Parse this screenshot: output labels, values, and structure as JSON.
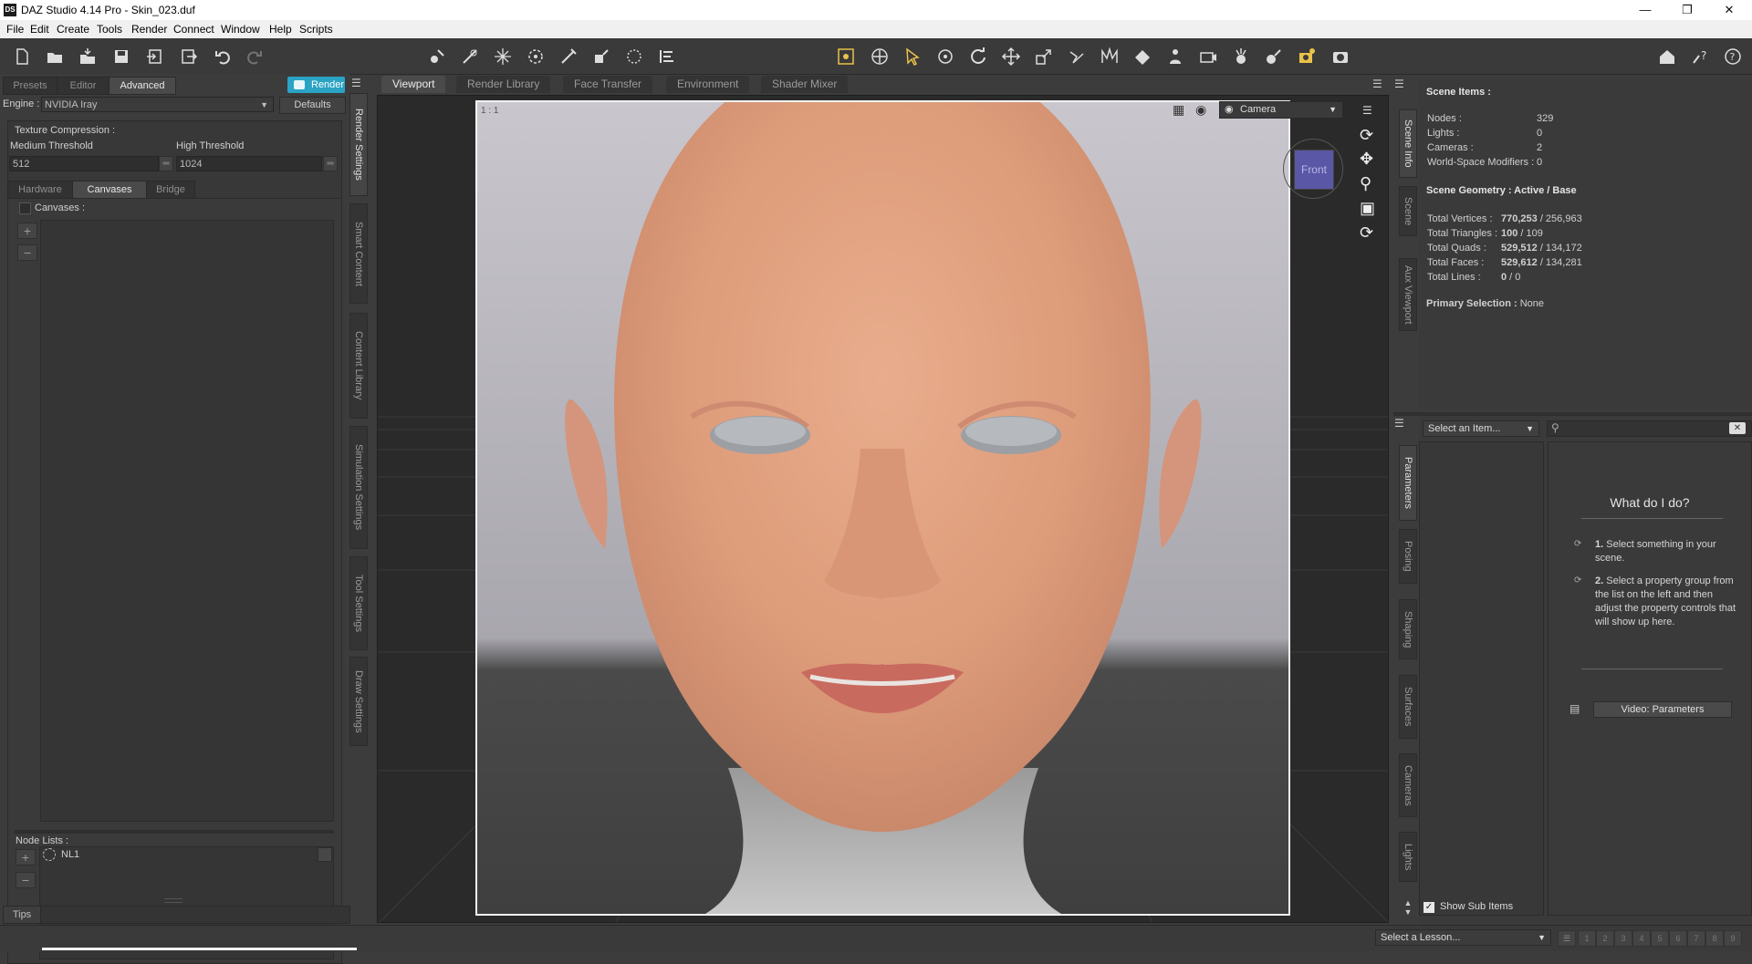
{
  "window": {
    "title": "DAZ Studio 4.14 Pro - Skin_023.duf",
    "logo": "DS",
    "buttons": [
      "minimize-icon",
      "maximize-icon",
      "close-icon"
    ]
  },
  "menu": [
    "File",
    "Edit",
    "Create",
    "Tools",
    "Render",
    "Connect",
    "Window",
    "Help",
    "Scripts"
  ],
  "left": {
    "tabs": [
      "Presets",
      "Editor",
      "Advanced"
    ],
    "render_button": "Render",
    "engine_label": "Engine :",
    "engine_value": "NVIDIA Iray",
    "defaults_button": "Defaults",
    "texture_compression": "Texture Compression :",
    "medium_label": "Medium Threshold",
    "medium_value": "512",
    "high_label": "High Threshold",
    "high_value": "1024",
    "subtabs": [
      "Hardware",
      "Canvases",
      "Bridge"
    ],
    "canvases_label": "Canvases :",
    "node_lists_label": "Node Lists :",
    "node_list_item": "NL1",
    "tips_tab": "Tips"
  },
  "left_vtabs": [
    "Render Settings",
    "Smart Content",
    "Content Library",
    "Simulation Settings",
    "Tool Settings",
    "Draw Settings"
  ],
  "viewport": {
    "tabs": [
      "Viewport",
      "Render Library",
      "Face Transfer",
      "Environment",
      "Shader Mixer"
    ],
    "ratio": "1 : 1",
    "camera": "Camera",
    "cube_face": "Front"
  },
  "scene_info": {
    "title": "Scene Items :",
    "items": [
      {
        "label": "Nodes :",
        "value": "329"
      },
      {
        "label": "Lights :",
        "value": "0"
      },
      {
        "label": "Cameras :",
        "value": "2"
      },
      {
        "label": "World-Space Modifiers :",
        "value": "0"
      }
    ],
    "geometry_title": "Scene Geometry : Active / Base",
    "geometry": [
      {
        "label": "Total Vertices :",
        "active": "770,253",
        "base": " / 256,963"
      },
      {
        "label": "Total Triangles :",
        "active": "100",
        "base": " / 109"
      },
      {
        "label": "Total Quads :",
        "active": "529,512",
        "base": " / 134,172"
      },
      {
        "label": "Total Faces :",
        "active": "529,612",
        "base": " / 134,281"
      },
      {
        "label": "Total Lines :",
        "active": "0",
        "base": " / 0"
      }
    ],
    "primary_label": "Primary Selection :",
    "primary_value": "None"
  },
  "right_vtabs_top": [
    "Scene Info",
    "Scene",
    "Aux Viewport"
  ],
  "right_vtabs_bottom": [
    "Parameters",
    "Posing",
    "Shaping",
    "Surfaces",
    "Cameras",
    "Lights"
  ],
  "params": {
    "select_item": "Select an Item...",
    "help_title": "What do I do?",
    "step1_num": "1.",
    "step1": "Select something in your scene.",
    "step2_num": "2.",
    "step2": "Select a property group from the list on the left and then adjust the property controls that will show up here.",
    "video_button": "Video: Parameters",
    "show_sub_items": "Show Sub Items"
  },
  "status": {
    "lesson": "Select a Lesson...",
    "pages": [
      "1",
      "2",
      "3",
      "4",
      "5",
      "6",
      "7",
      "8",
      "9"
    ]
  },
  "colors": {
    "accent": "#2aa3c4",
    "panel": "#3c3c3c",
    "frame": "#f2f2f2"
  }
}
